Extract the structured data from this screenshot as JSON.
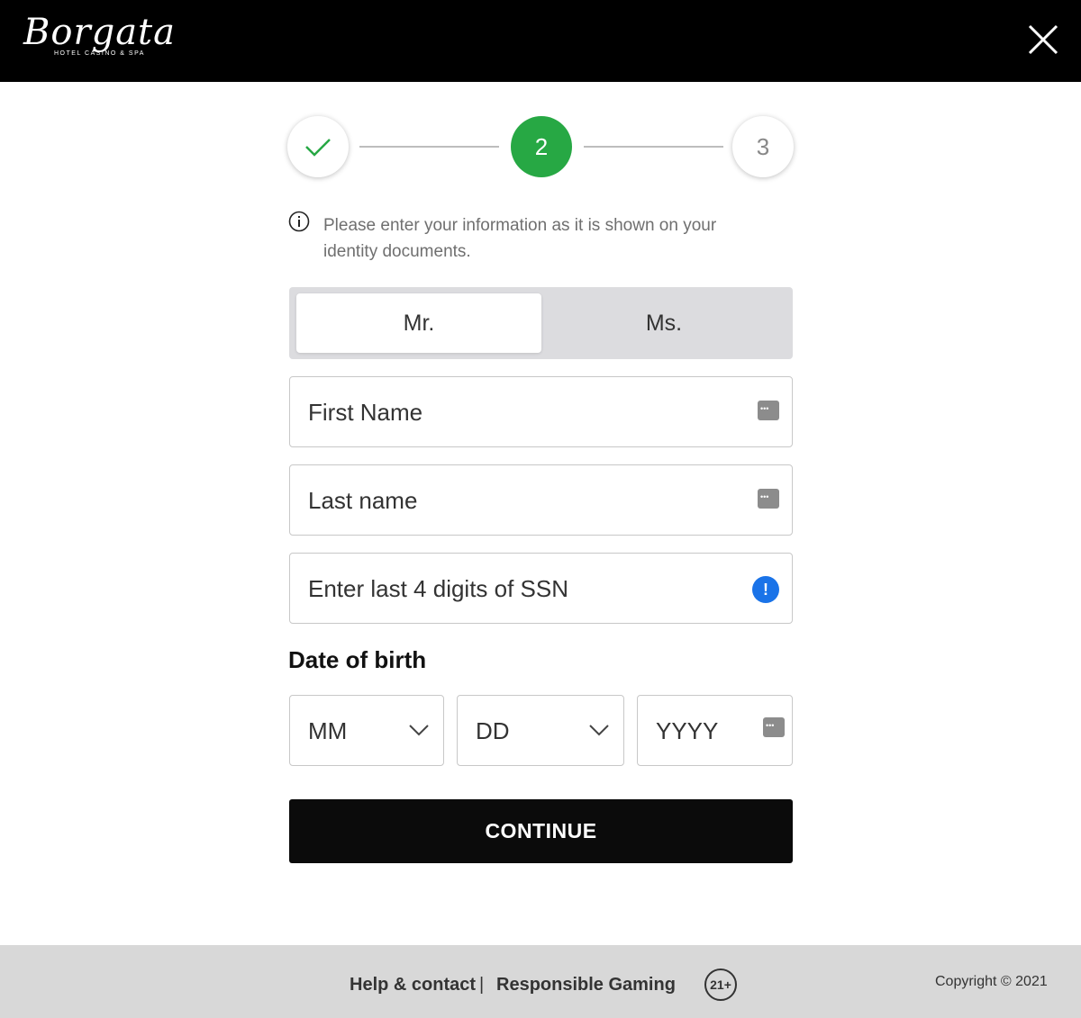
{
  "header": {
    "logo_text": "Borgata",
    "logo_subtext": "HOTEL CASINO & SPA",
    "close_icon": "close-icon"
  },
  "stepper": {
    "steps": [
      {
        "label": "",
        "state": "done",
        "icon": "check-icon"
      },
      {
        "label": "2",
        "state": "active"
      },
      {
        "label": "3",
        "state": "pending"
      }
    ],
    "active_color": "#27a844"
  },
  "info": {
    "icon": "info-icon",
    "text": "Please enter your information as it is shown on your identity documents."
  },
  "title_toggle": {
    "options": [
      "Mr.",
      "Ms."
    ],
    "selected": "Mr."
  },
  "fields": {
    "first_name": "First Name",
    "last_name": "Last name",
    "ssn": "Enter last 4 digits of SSN"
  },
  "dob": {
    "title": "Date of birth",
    "month": "MM",
    "day": "DD",
    "year": "YYYY"
  },
  "continue_label": "CONTINUE",
  "footer": {
    "help": "Help & contact",
    "separator": "|",
    "responsible": "Responsible Gaming",
    "age_badge": "21+",
    "copyright": "Copyright © 2021"
  }
}
